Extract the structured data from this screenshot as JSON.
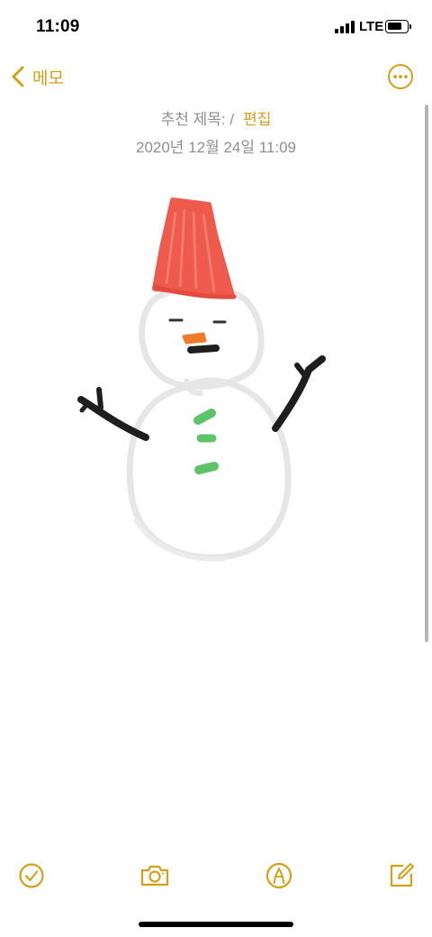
{
  "status_bar": {
    "time": "11:09",
    "network": "LTE",
    "battery_level": 0.7
  },
  "nav": {
    "back_label": "메모",
    "more_icon": "ellipsis-circle-icon"
  },
  "note": {
    "title_prefix": "추천 제목: /",
    "edit_label": "편집",
    "date": "2020년 12월 24일 11:09"
  },
  "toolbar": {
    "items": [
      "checklist-icon",
      "camera-icon",
      "markup-pen-icon",
      "compose-icon"
    ]
  },
  "colors": {
    "accent": "#d4a017",
    "secondary_text": "#8e8e93"
  }
}
